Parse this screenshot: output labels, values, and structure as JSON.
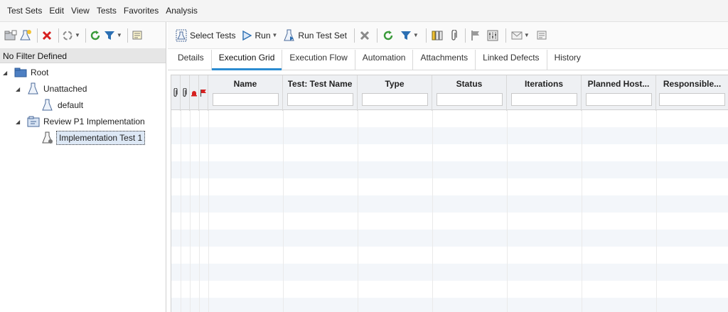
{
  "menu": [
    "Test Sets",
    "Edit",
    "View",
    "Tests",
    "Favorites",
    "Analysis"
  ],
  "left": {
    "filter_text": "No Filter Defined",
    "tree": {
      "root": "Root",
      "unattached": "Unattached",
      "default": "default",
      "review": "Review P1 Implementation",
      "impl_test": "Implementation Test 1"
    }
  },
  "toolbar": {
    "select_tests": "Select Tests",
    "run": "Run",
    "run_test_set": "Run Test Set"
  },
  "tabs": [
    "Details",
    "Execution Grid",
    "Execution Flow",
    "Automation",
    "Attachments",
    "Linked Defects",
    "History"
  ],
  "active_tab": "Execution Grid",
  "grid": {
    "columns": [
      "Name",
      "Test: Test Name",
      "Type",
      "Status",
      "Iterations",
      "Planned Host...",
      "Responsible..."
    ]
  },
  "colors": {
    "accent": "#2b8bd1",
    "refresh": "#3a9a3a",
    "delete": "#d62020",
    "flag": "#d62020"
  }
}
